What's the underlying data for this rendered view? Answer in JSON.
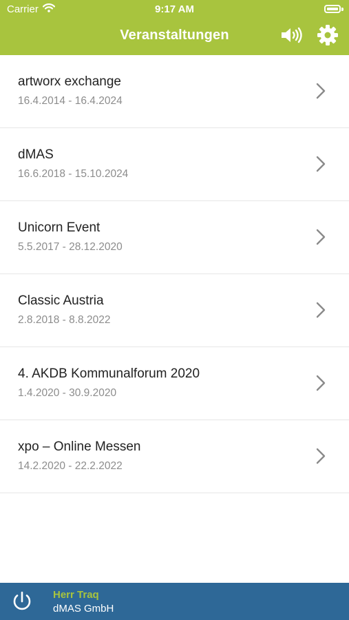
{
  "status_bar": {
    "carrier": "Carrier",
    "time": "9:17 AM"
  },
  "nav": {
    "title": "Veranstaltungen"
  },
  "events": [
    {
      "title": "artworx exchange",
      "dates": "16.4.2014 - 16.4.2024"
    },
    {
      "title": "dMAS",
      "dates": "16.6.2018 - 15.10.2024"
    },
    {
      "title": "Unicorn Event",
      "dates": "5.5.2017 - 28.12.2020"
    },
    {
      "title": "Classic Austria",
      "dates": "2.8.2018 - 8.8.2022"
    },
    {
      "title": "4. AKDB Kommunalforum 2020",
      "dates": "1.4.2020 - 30.9.2020"
    },
    {
      "title": "xpo – Online Messen",
      "dates": "14.2.2020 - 22.2.2022"
    }
  ],
  "footer": {
    "user_name": "Herr Traq",
    "company": "dMAS GmbH"
  },
  "colors": {
    "accent": "#a8c43e",
    "footer": "#2e6897"
  },
  "icons": {
    "wifi": "wifi-icon",
    "battery": "battery-icon",
    "sound": "speaker-icon",
    "settings": "gear-icon",
    "chevron": "chevron-right-icon",
    "power": "power-icon"
  }
}
